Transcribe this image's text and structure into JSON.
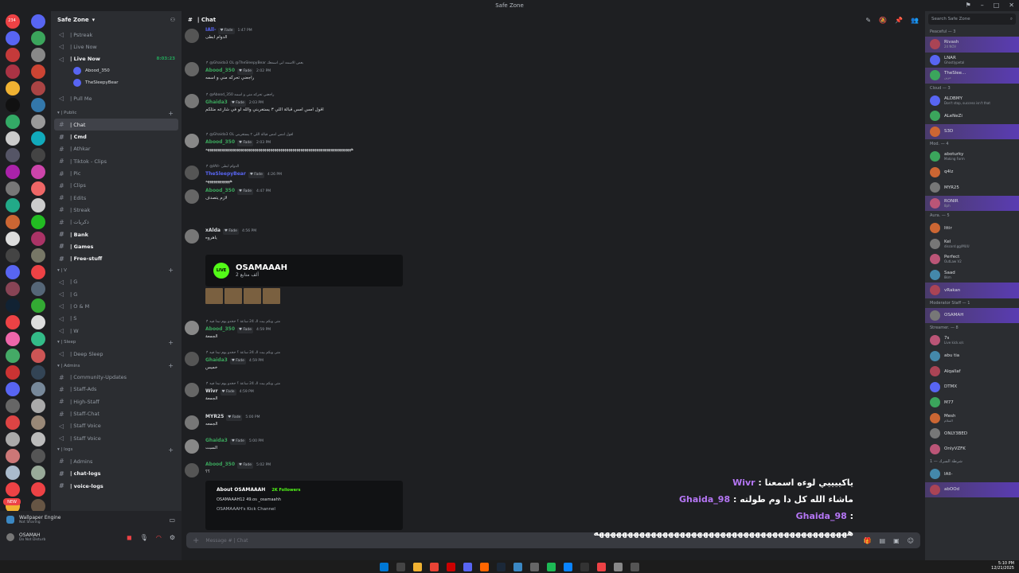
{
  "window": {
    "title": "Safe Zone"
  },
  "servers": {
    "col1": [
      "#ed4245",
      "#5865f2",
      "#c43a3a",
      "#a34",
      "#f0b232",
      "#111",
      "#3a6",
      "#ccc",
      "#556",
      "#a2a",
      "#777",
      "#2a8",
      "#c63",
      "#ddd",
      "#444",
      "#5865f2",
      "#845",
      "#123",
      "#ed4245",
      "#e6a",
      "#4a6",
      "#c33",
      "#5865f2",
      "#666",
      "#d44",
      "#aaa",
      "#c77",
      "#abc",
      "#ed4245",
      "#f0b232"
    ],
    "col2": [
      "#5865f2",
      "#3ba55c",
      "#888",
      "#c43",
      "#a44",
      "#37a",
      "#999",
      "#1ab",
      "#444",
      "#c4a",
      "#e66",
      "#ccc",
      "#2b2",
      "#a36",
      "#776",
      "#ed4245",
      "#567",
      "#3a3",
      "#ddd",
      "#3b8",
      "#c55",
      "#345",
      "#789",
      "#aaa",
      "#987",
      "#bbb",
      "#555",
      "#9a9",
      "#ed4245",
      "#654"
    ],
    "badge_top": "234",
    "new_badge": "NEW"
  },
  "channels": {
    "server_name": "Safe Zone",
    "items_top": [
      {
        "label": "| Pstreak",
        "bold": false
      },
      {
        "label": "| Live Now",
        "bold": false
      },
      {
        "label": "| Live Now",
        "bold": true,
        "live_time": "8:03:23"
      }
    ],
    "voice_users": [
      "Abood_350",
      "TheSleepyBear"
    ],
    "pull_me": "| Pull Me",
    "public_cat": "| Public",
    "public_channels": [
      "| Chat",
      "| Cmd",
      "| Athkar",
      "| Tiktok - Clips",
      "| Pic",
      "| Clips",
      "| Edits",
      "| Streak",
      "| ذكريات",
      "| Bank",
      "| Games",
      "| Free-stuff"
    ],
    "v_cat": "| V",
    "v_channels": [
      "| G",
      "| G",
      "| O & M",
      "| S",
      "| W"
    ],
    "sleep_cat": "| Sleep",
    "sleep_channels": [
      "| Deep Sleep"
    ],
    "admins_cat": "| Admins",
    "admin_channels": [
      "| Community-Updates",
      "| Staff-Ads",
      "| High-Staff",
      "| Staff-Chat",
      "| Staff Voice",
      "| Staff Voice"
    ],
    "logs_cat": "| logs",
    "log_channels": [
      "| Admins",
      "| chat-logs",
      "| voice-logs"
    ]
  },
  "userbar": {
    "activity": "Wallpaper Engine",
    "activity_sub": "Not Sharing",
    "username": "OSAMAH",
    "status": "Do Not Disturb"
  },
  "chat": {
    "channel": "| Chat",
    "messages": [
      {
        "user": "IAll-",
        "color": "#5865f2",
        "time": "1:47 PM",
        "text": "الدوام ابطى",
        "reply": ""
      },
      {
        "user": "Abood_350",
        "color": "#3ba55c",
        "time": "2:02 PM",
        "text": "راجعني تحركه مني و اسمه",
        "reply": "@Ghaida3 OL @TheSleepyBear بعض الاسمه ابي اسمعك"
      },
      {
        "user": "Ghaida3",
        "color": "#3ba55c",
        "time": "2:03 PM",
        "text": "اقول امس امس قبالة اللي ٣ يستغربني والله لو في شارعه مثلكم",
        "reply": "@Abood_350 راجعني تحركه مني و اسمه"
      },
      {
        "user": "Abood_350",
        "color": "#3ba55c",
        "time": "2:03 PM",
        "text": "ههههههههههههههههههههههههههههههههههههههههههههههههههههههههههههههههههههههههه",
        "reply": "@Ghaida3 OL اقول امس امس قبالة اللي ٣ يستغربني"
      },
      {
        "user": "TheSleepyBear",
        "color": "#5865f2",
        "time": "4:26 PM",
        "text": "ههههههههههههه",
        "reply": "@IAll- الدوام ابطى"
      },
      {
        "user": "Abood_350",
        "color": "#3ba55c",
        "time": "4:47 PM",
        "text": "لازم يتصدف",
        "reply": ""
      },
      {
        "user": "xAlda",
        "color": "#dbdee1",
        "time": "4:56 PM",
        "text": "ياهروه",
        "reply": ""
      },
      {
        "user": "Abood_350",
        "color": "#3ba55c",
        "time": "4:59 PM",
        "text": "الجمعة",
        "reply": "متى وبكم بيت الـ 24 ساعة ؟ حخدو يوم نبدا فيه"
      },
      {
        "user": "Ghaida3",
        "color": "#3ba55c",
        "time": "4:59 PM",
        "text": "خميس",
        "reply": "متى وبكم بيت الـ 24 ساعة ؟ حخدو يوم نبدا فيه"
      },
      {
        "user": "Wivr",
        "color": "#dbdee1",
        "time": "4:59 PM",
        "text": "الجمعة",
        "reply": "متى وبكم بيت الـ 24 ساعة ؟ حخدو يوم نبدا فيه"
      },
      {
        "user": "MYR25",
        "color": "#dbdee1",
        "time": "5:00 PM",
        "text": "الجمعه",
        "reply": ""
      },
      {
        "user": "Ghaida3",
        "color": "#3ba55c",
        "time": "5:00 PM",
        "text": "السبت",
        "reply": ""
      },
      {
        "user": "Abood_350",
        "color": "#3ba55c",
        "time": "5:02 PM",
        "text": "؟؟",
        "reply": ""
      }
    ],
    "live_embed": {
      "name": "OSAMAAAH",
      "badge": "LIVE",
      "followers": "2 ألف متابع"
    },
    "about_embed": {
      "title": "About OSAMAAAH",
      "followers": "2K Followers",
      "links": "OSAMAAAH12   49.os   _osamaahh",
      "desc": "OSAMAAAH's Kick Channel"
    },
    "composer_placeholder": "Message #  | Chat"
  },
  "overlay": {
    "lines": [
      {
        "name": "Wivr",
        "text": "ياكييييي لوءه اسمعنا"
      },
      {
        "name": "Ghaida_98",
        "text": "ماشاء الله كل دا وم طولته"
      },
      {
        "name": "Ghaida_98",
        "text": "ههههههههههههههههههههههههههههههههههههههههههههه"
      }
    ]
  },
  "members": {
    "search_placeholder": "Search Safe Zone",
    "groups": [
      {
        "title": "Peaceful — 3",
        "items": [
          {
            "name": "Rivash",
            "sub": "24 NOV",
            "hl": true
          },
          {
            "name": "LNAR",
            "sub": "Ghostlypetal",
            "hl": false
          },
          {
            "name": "TheSlee...",
            "sub": "حزين",
            "hl": true
          }
        ]
      },
      {
        "title": "Cloud — 3",
        "items": [
          {
            "name": "ALDBMY",
            "sub": "Don't stop, success isn't that",
            "hl": false
          },
          {
            "name": "ALeNeZi",
            "sub": "",
            "hl": false
          },
          {
            "name": "S3D",
            "sub": "",
            "hl": true
          }
        ]
      },
      {
        "title": "Mod. — 4",
        "items": [
          {
            "name": "aboturky",
            "sub": "Making Form",
            "hl": false
          },
          {
            "name": "q4lz",
            "sub": "",
            "hl": false
          },
          {
            "name": "MYR25",
            "sub": "",
            "hl": false
          },
          {
            "name": "RONIR",
            "sub": "8ph",
            "hl": true
          }
        ]
      },
      {
        "title": "Aura. — 5",
        "items": [
          {
            "name": "Ittir",
            "sub": "",
            "hl": false
          },
          {
            "name": "Kel",
            "sub": "discord.gg/MUU",
            "hl": false
          },
          {
            "name": "Perfect",
            "sub": "OutLaw V2",
            "hl": false
          },
          {
            "name": "Saad",
            "sub": "8km",
            "hl": false
          },
          {
            "name": "vRakan",
            "sub": "",
            "hl": true
          }
        ]
      },
      {
        "title": "Moderator Staff — 1",
        "items": [
          {
            "name": "OSAMAH",
            "sub": "",
            "hl": true
          }
        ]
      },
      {
        "title": "Streamer. — 8",
        "items": [
          {
            "name": "7s",
            "sub": "Live kick.x/s",
            "hl": false
          },
          {
            "name": "abu tia",
            "sub": "",
            "hl": false
          },
          {
            "name": "Alqallaf",
            "sub": "",
            "hl": false
          },
          {
            "name": "DTMX",
            "sub": "",
            "hl": false
          },
          {
            "name": "M77",
            "sub": "",
            "hl": false
          },
          {
            "name": "Mesh",
            "sub": "السلام",
            "hl": false
          },
          {
            "name": "ONLY3BED",
            "sub": "",
            "hl": false
          },
          {
            "name": "OnlyVZFK",
            "sub": "",
            "hl": false
          }
        ]
      },
      {
        "title": "شرطة السرك — 1",
        "items": [
          {
            "name": "IAll-",
            "sub": "",
            "hl": false
          },
          {
            "name": "abOOd",
            "sub": "",
            "hl": true
          }
        ]
      }
    ]
  },
  "taskbar": {
    "time": "5:10 PM",
    "date": "12/21/2025"
  }
}
